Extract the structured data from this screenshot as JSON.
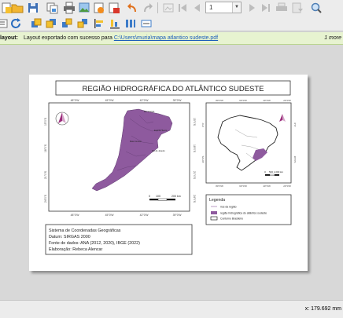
{
  "colors": {
    "basin_fill": "#8e5a9e",
    "message_bg": "#e7f3d0",
    "link": "#1a5dbb",
    "north_arrow": "#9b2e7b"
  },
  "toolbar": {
    "page_number": "1"
  },
  "message_bar": {
    "title": "layout:",
    "text": "Layout exportado com sucesso para",
    "link": "C:\\Users\\muria\\mapa atlantico sudeste.pdf",
    "more": "1 more"
  },
  "layout": {
    "title": "REGIÃO HIDROGRÁFICA DO ATLÂNTICO SUDESTE",
    "main_map": {
      "top_ticks": [
        "48°0'W",
        "45°0'W",
        "42°0'W",
        "39°0'W"
      ],
      "bottom_ticks": [
        "48°0'W",
        "45°0'W",
        "42°0'W",
        "39°0'W"
      ],
      "left_ticks": [
        "15°0'S",
        "18°0'S",
        "21°0'S",
        "24°0'S"
      ],
      "right_ticks": [
        "15°0'S",
        "18°0'S",
        "21°0'S",
        "24°0'S"
      ],
      "place_labels": [
        "Espírito Santo",
        "Rio Grande",
        "Mato Grosso",
        "Rio de Janeiro"
      ],
      "scale_labels": [
        "0",
        "100",
        "200 km"
      ]
    },
    "inset_map": {
      "top_ticks": [
        "80°0'W",
        "60°0'W",
        "40°0'W",
        "20°0'W"
      ],
      "bottom_ticks": [
        "80°0'W",
        "60°0'W",
        "40°0'W",
        "20°0'W"
      ],
      "left_ticks": [
        "0°0'",
        "20°0'S"
      ],
      "right_ticks": [
        "0°0'",
        "20°0'S"
      ],
      "scale_labels": [
        "0",
        "500 1.000 km"
      ]
    },
    "legend": {
      "title": "Legenda",
      "items": [
        "rios da região",
        "região hidrográfica do atlântico sudeste",
        "Contorno Brasileiro"
      ]
    },
    "info": [
      "Sistema de Coordenadas Geográficas",
      "Datum: SIRGAS 2000",
      "Fonte de dados: ANA (2012, 2020), IBGE (2022)",
      "Elaboração: Rebeca Alencar"
    ]
  },
  "status_bar": {
    "coordinate": "x: 179.692 mm"
  }
}
